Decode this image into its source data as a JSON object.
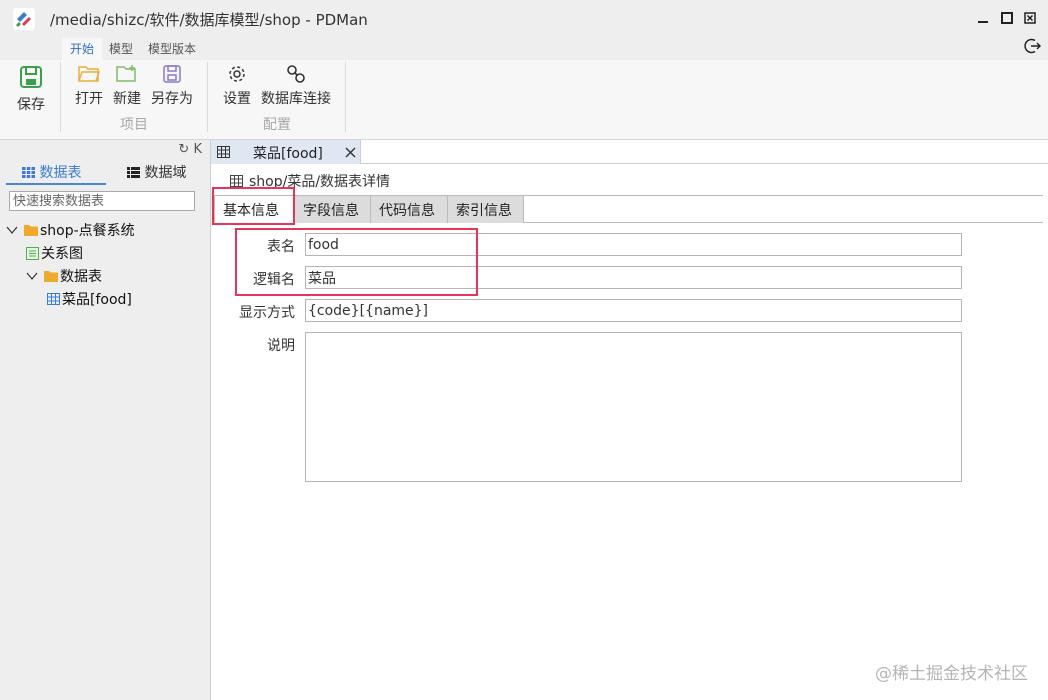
{
  "window": {
    "title": "/media/shizc/软件/数据库模型/shop - PDMan"
  },
  "ribbon_tabs": [
    {
      "label": "开始",
      "active": true
    },
    {
      "label": "模型",
      "active": false
    },
    {
      "label": "模型版本",
      "active": false
    }
  ],
  "ribbon": {
    "save_label": "保存",
    "open_label": "打开",
    "new_label": "新建",
    "save_as_label": "另存为",
    "project_group_label": "项目",
    "settings_label": "设置",
    "db_connect_label": "数据库连接",
    "config_group_label": "配置"
  },
  "left_panel": {
    "tools": {
      "collapse_label": "K"
    },
    "tabs": [
      {
        "label": "数据表",
        "active": true
      },
      {
        "label": "数据域",
        "active": false
      }
    ],
    "search_placeholder": "快速搜索数据表",
    "tree": [
      {
        "label": "shop-点餐系统",
        "level": 0,
        "icon": "folder-icon",
        "toggle": "expanded"
      },
      {
        "label": "关系图",
        "level": 1,
        "icon": "diagram-icon"
      },
      {
        "label": "数据表",
        "level": 1,
        "icon": "folder-icon",
        "toggle": "expanded"
      },
      {
        "label": "菜品[food]",
        "level": 2,
        "icon": "table-icon"
      }
    ]
  },
  "doc_tab": {
    "label": "菜品[food]"
  },
  "breadcrumb": "shop/菜品/数据表详情",
  "sub_tabs": [
    {
      "label": "基本信息",
      "active": true
    },
    {
      "label": "字段信息",
      "active": false
    },
    {
      "label": "代码信息",
      "active": false
    },
    {
      "label": "索引信息",
      "active": false
    }
  ],
  "form": {
    "table_name_label": "表名",
    "table_name_value": "food",
    "logic_name_label": "逻辑名",
    "logic_name_value": "菜品",
    "display_label": "显示方式",
    "display_value": "{code}[{name}]",
    "desc_label": "说明",
    "desc_value": ""
  },
  "colors": {
    "accent": "#3a7bd5",
    "highlight": "#e8335a",
    "save_icon": "#3aa04a"
  },
  "watermark": "@稀土掘金技术社区"
}
